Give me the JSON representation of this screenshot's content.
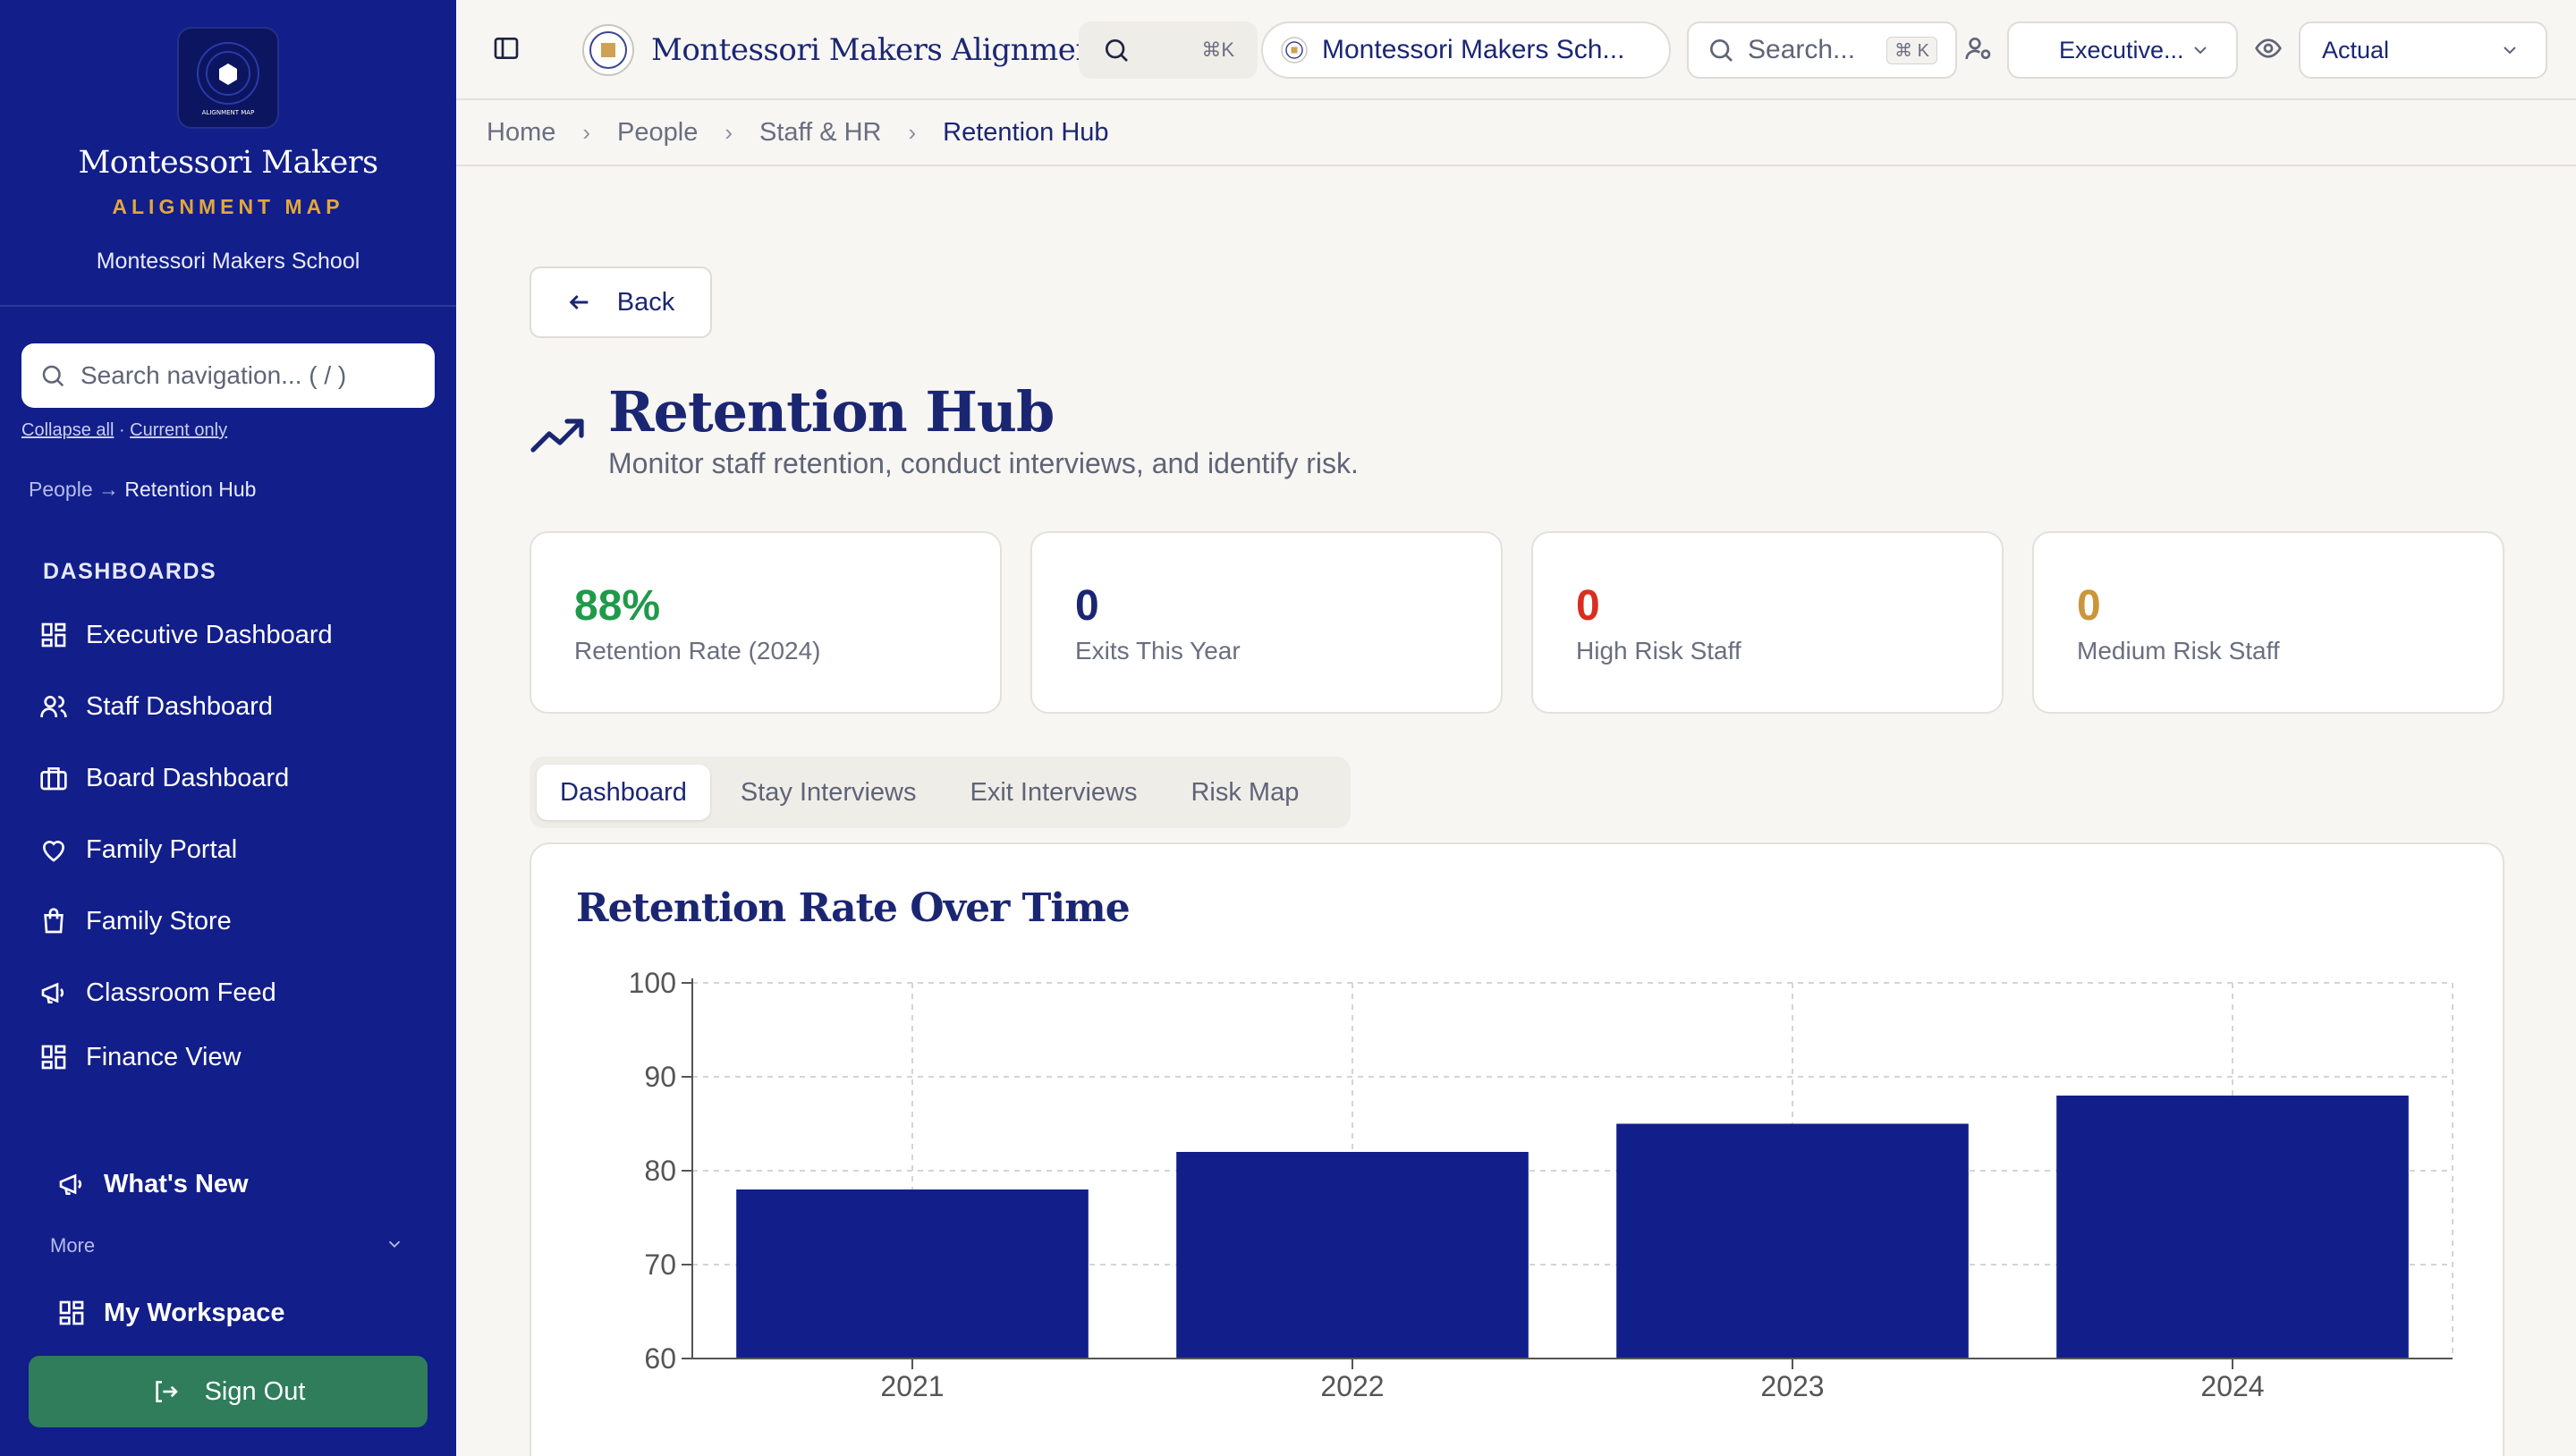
{
  "sidebar": {
    "brand_name": "Montessori Makers",
    "brand_sub": "ALIGNMENT MAP",
    "logo_text": "ALIGNMENT MAP",
    "school": "Montessori Makers School",
    "search_placeholder": "Search navigation... ( / )",
    "collapse_all": "Collapse all",
    "current_only": "Current only",
    "crumb_parent": "People",
    "crumb_arrow": "→",
    "crumb_current": "Retention Hub",
    "section": "DASHBOARDS",
    "items": [
      {
        "label": "Executive Dashboard",
        "icon": "dashboard-icon"
      },
      {
        "label": "Staff Dashboard",
        "icon": "users-icon"
      },
      {
        "label": "Board Dashboard",
        "icon": "briefcase-icon"
      },
      {
        "label": "Family Portal",
        "icon": "heart-icon"
      },
      {
        "label": "Family Store",
        "icon": "shopping-bag-icon"
      },
      {
        "label": "Classroom Feed",
        "icon": "megaphone-icon"
      },
      {
        "label": "Finance View",
        "icon": "dashboard-icon"
      }
    ],
    "whats_new": "What's New",
    "more": "More",
    "my_workspace": "My Workspace",
    "sign_out": "Sign Out"
  },
  "topbar": {
    "app_title": "Montessori Makers Alignmen...",
    "cmd_shortcut": "⌘K",
    "school_select": "Montessori Makers Sch...",
    "search_placeholder": "Search...",
    "search_shortcut": "⌘ K",
    "role_select": "Executive...",
    "view_select": "Actual"
  },
  "breadcrumb": [
    "Home",
    "People",
    "Staff & HR",
    "Retention Hub"
  ],
  "page": {
    "back": "Back",
    "title": "Retention Hub",
    "subtitle": "Monitor staff retention, conduct interviews, and identify risk."
  },
  "stats": [
    {
      "value": "88%",
      "label": "Retention Rate (2024)",
      "color": "#1f9a4a"
    },
    {
      "value": "0",
      "label": "Exits This Year",
      "color": "#1b2673"
    },
    {
      "value": "0",
      "label": "High Risk Staff",
      "color": "#d92d20"
    },
    {
      "value": "0",
      "label": "Medium Risk Staff",
      "color": "#c9973a"
    }
  ],
  "tabs": [
    "Dashboard",
    "Stay Interviews",
    "Exit Interviews",
    "Risk Map"
  ],
  "colors": {
    "primary": "#121e8a",
    "accent": "#e1a83a",
    "signout": "#2f7d5b",
    "bar": "#121e8a"
  },
  "chart_data": {
    "type": "bar",
    "title": "Retention Rate Over Time",
    "categories": [
      "2021",
      "2022",
      "2023",
      "2024"
    ],
    "values": [
      78,
      82,
      85,
      88
    ],
    "ylim": [
      60,
      100
    ],
    "yticks": [
      60,
      70,
      80,
      90,
      100
    ],
    "grid": true
  }
}
